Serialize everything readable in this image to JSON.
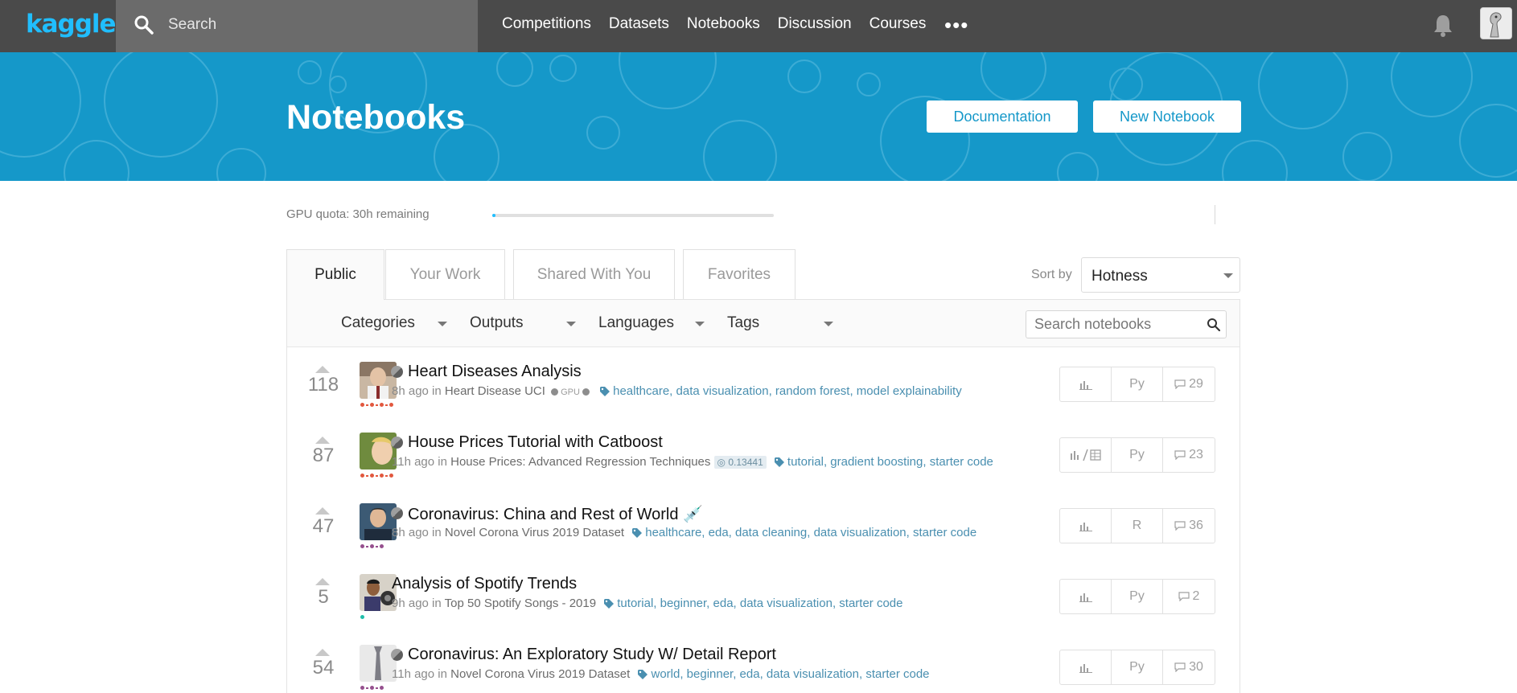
{
  "header": {
    "logo": "kaggle",
    "search_placeholder": "Search",
    "nav": [
      "Competitions",
      "Datasets",
      "Notebooks",
      "Discussion",
      "Courses"
    ],
    "more": "•••"
  },
  "banner": {
    "title": "Notebooks",
    "documentation_label": "Documentation",
    "new_notebook_label": "New Notebook"
  },
  "quota": {
    "text": "GPU quota: 30h remaining",
    "used_fraction": 0.01
  },
  "tabs": [
    "Public",
    "Your Work",
    "Shared With You",
    "Favorites"
  ],
  "sort": {
    "label": "Sort by",
    "value": "Hotness"
  },
  "filters": [
    "Categories",
    "Outputs",
    "Languages",
    "Tags"
  ],
  "notebook_search_placeholder": "Search notebooks",
  "notebooks": [
    {
      "votes": "118",
      "title": "Heart Diseases Analysis",
      "time": "8h ago in ",
      "source": "Heart Disease UCI",
      "gpu": "GPU",
      "tags": "healthcare, data visualization, random forest, model explainability",
      "language": "Py",
      "comments": "29"
    },
    {
      "votes": "87",
      "title": "House Prices Tutorial with Catboost",
      "time": "11h ago in ",
      "source": "House Prices: Advanced Regression Techniques",
      "score": "0.13441",
      "tags": "tutorial, gradient boosting, starter code",
      "language": "Py",
      "comments": "23"
    },
    {
      "votes": "47",
      "title": "Coronavirus: China and Rest of World",
      "title_emoji": "💉",
      "time": "8h ago in ",
      "source": "Novel Corona Virus 2019 Dataset",
      "tags": "healthcare, eda, data cleaning, data visualization, starter code",
      "language": "R",
      "comments": "36"
    },
    {
      "votes": "5",
      "title": "Analysis of Spotify Trends",
      "time": "9h ago in ",
      "source": "Top 50 Spotify Songs - 2019",
      "tags": "tutorial, beginner, eda, data visualization, starter code",
      "language": "Py",
      "comments": "2"
    },
    {
      "votes": "54",
      "title": "Coronavirus: An Exploratory Study W/ Detail Report",
      "time": "11h ago in ",
      "source": "Novel Corona Virus 2019 Dataset",
      "tags": "world, beginner, eda, data visualization, starter code",
      "language": "Py",
      "comments": "30"
    }
  ],
  "colors": {
    "topbar": "#4a4a4a",
    "brand": "#20beff",
    "banner": "#1598c9",
    "tag_link": "#4a8fb0"
  }
}
